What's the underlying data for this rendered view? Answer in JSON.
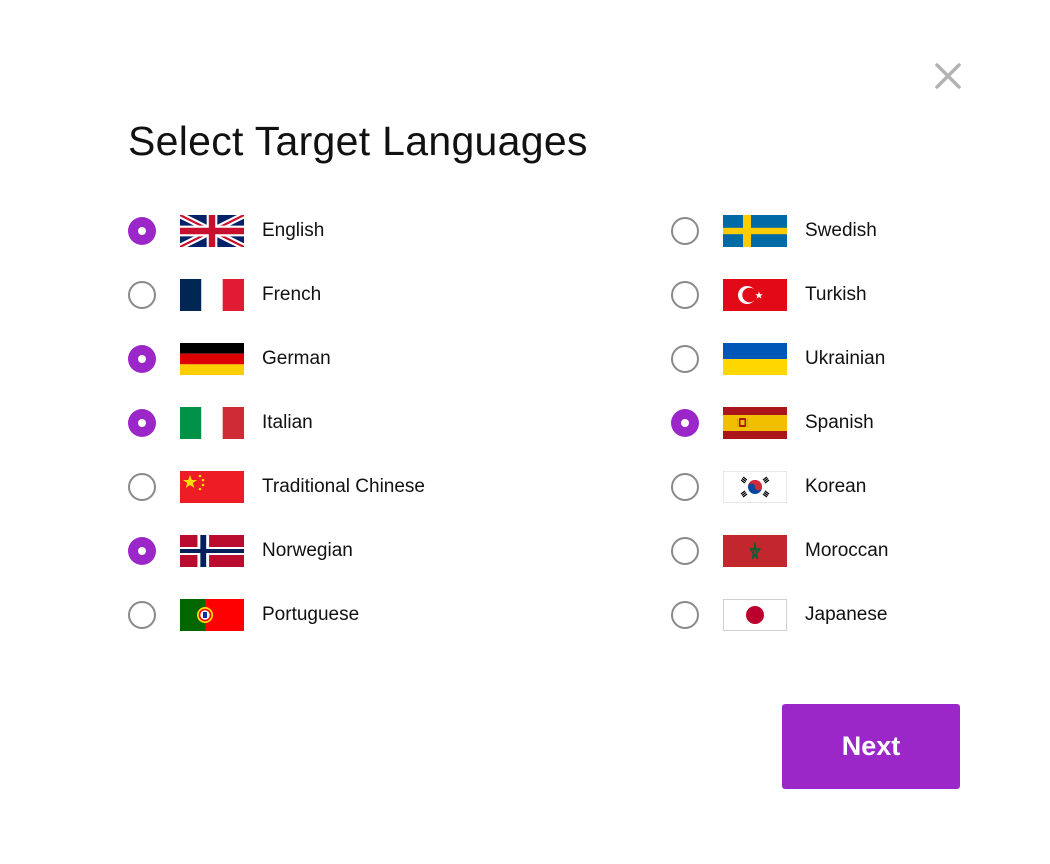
{
  "dialog": {
    "title": "Select Target Languages",
    "close_icon": "close-icon",
    "next_label": "Next",
    "accent_color": "#9b27c9"
  },
  "languages": {
    "left": [
      {
        "label": "English",
        "checked": true,
        "flag": "uk-flag-icon"
      },
      {
        "label": "French",
        "checked": false,
        "flag": "france-flag-icon"
      },
      {
        "label": "German",
        "checked": true,
        "flag": "germany-flag-icon"
      },
      {
        "label": "Italian",
        "checked": true,
        "flag": "italy-flag-icon"
      },
      {
        "label": "Traditional Chinese",
        "checked": false,
        "flag": "china-flag-icon"
      },
      {
        "label": "Norwegian",
        "checked": true,
        "flag": "norway-flag-icon"
      },
      {
        "label": "Portuguese",
        "checked": false,
        "flag": "portugal-flag-icon"
      }
    ],
    "right": [
      {
        "label": "Swedish",
        "checked": false,
        "flag": "sweden-flag-icon"
      },
      {
        "label": "Turkish",
        "checked": false,
        "flag": "turkey-flag-icon"
      },
      {
        "label": "Ukrainian",
        "checked": false,
        "flag": "ukraine-flag-icon"
      },
      {
        "label": "Spanish",
        "checked": true,
        "flag": "spain-flag-icon"
      },
      {
        "label": "Korean",
        "checked": false,
        "flag": "korea-flag-icon"
      },
      {
        "label": "Moroccan",
        "checked": false,
        "flag": "morocco-flag-icon"
      },
      {
        "label": "Japanese",
        "checked": false,
        "flag": "japan-flag-icon"
      }
    ]
  }
}
